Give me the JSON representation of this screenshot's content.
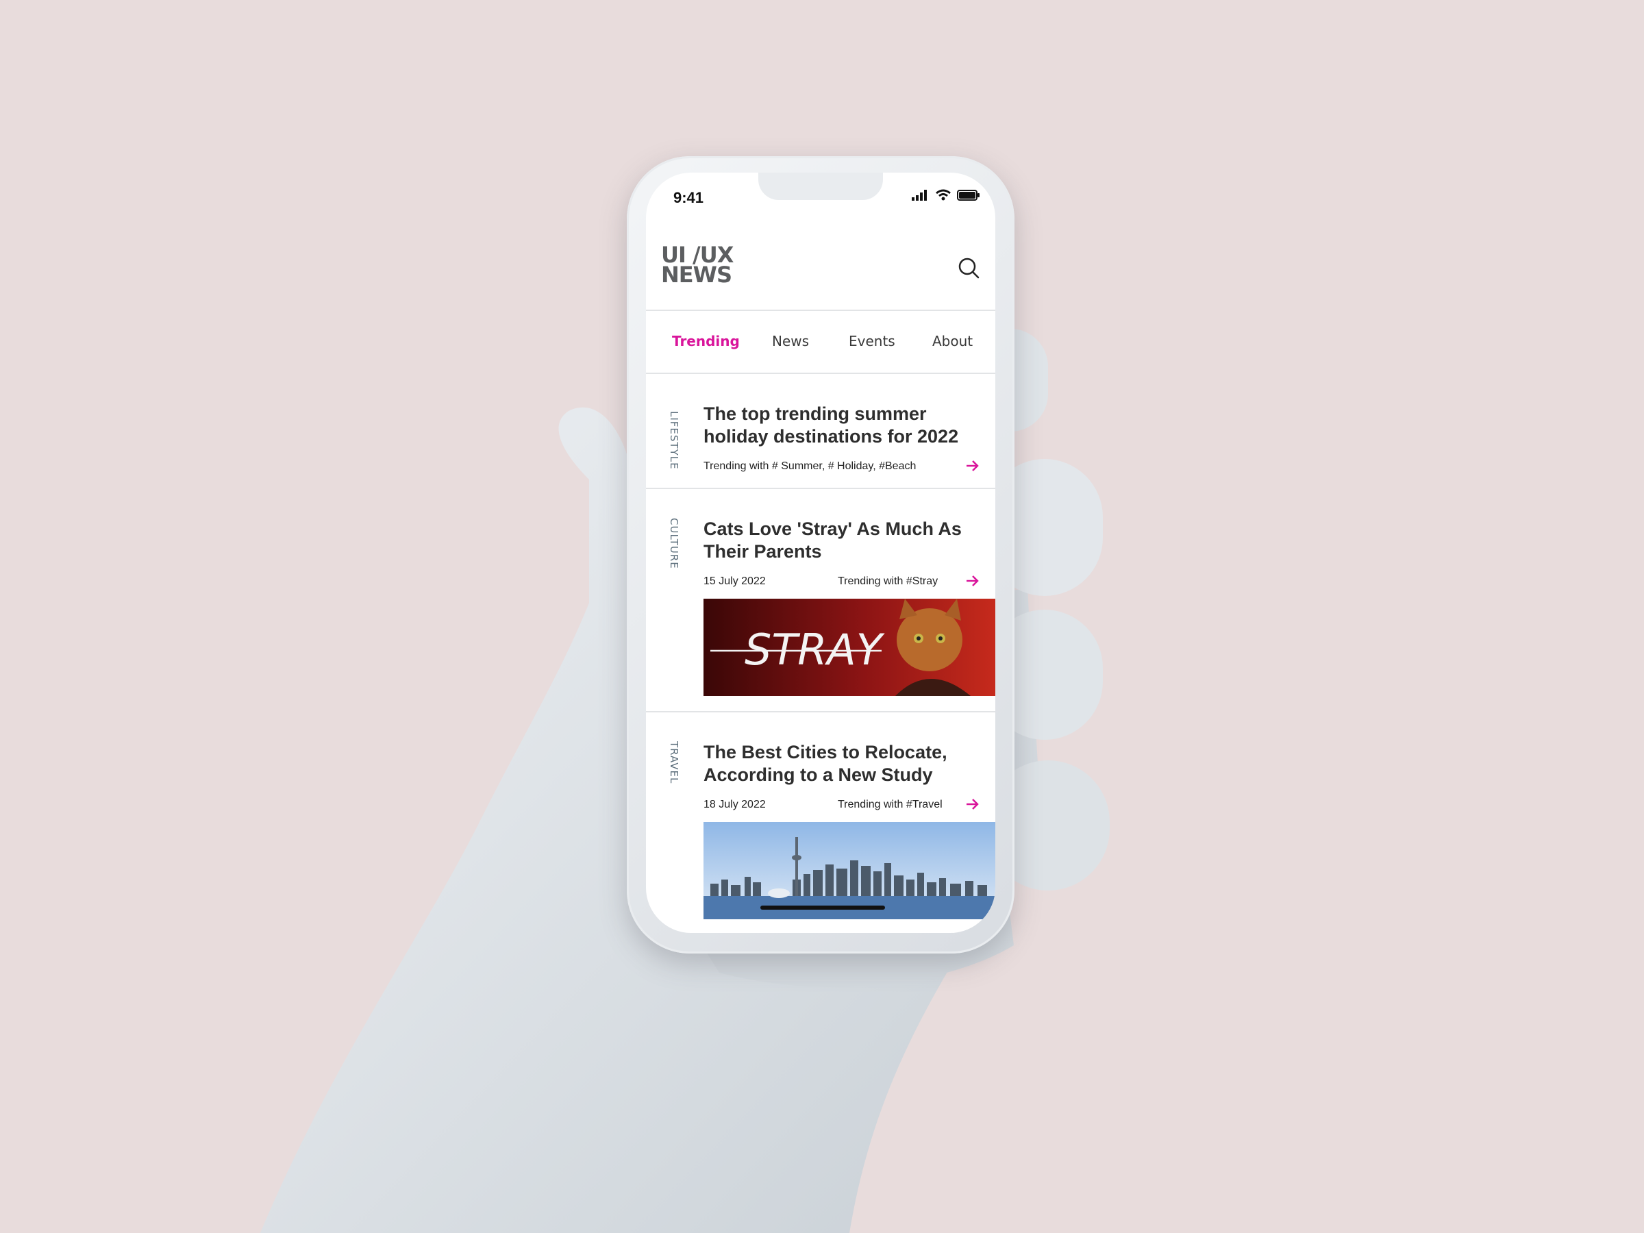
{
  "status_bar": {
    "time": "9:41"
  },
  "header": {
    "logo_line1": "UI /UX",
    "logo_line2": "NEWS",
    "search_icon": "search-icon"
  },
  "nav": {
    "tabs": [
      "Trending",
      "News",
      "Events",
      "About"
    ],
    "active": "Trending"
  },
  "colors": {
    "accent": "#d9159b",
    "background": "#e8dcdc",
    "text": "#2e2e2e"
  },
  "articles": [
    {
      "category": "LIFESTYLE",
      "title": "The top trending summer holiday destinations for 2022",
      "trending": "Trending with # Summer, # Holiday,  #Beach"
    },
    {
      "category": "CULTURE",
      "title": "Cats Love 'Stray' As Much As Their Parents",
      "date": "15 July  2022",
      "trending": "Trending with #Stray",
      "image_text": "STRAY"
    },
    {
      "category": "TRAVEL",
      "title": "The Best Cities to Relocate, According to a New Study",
      "date": "18 July  2022",
      "trending": "Trending with #Travel"
    }
  ]
}
